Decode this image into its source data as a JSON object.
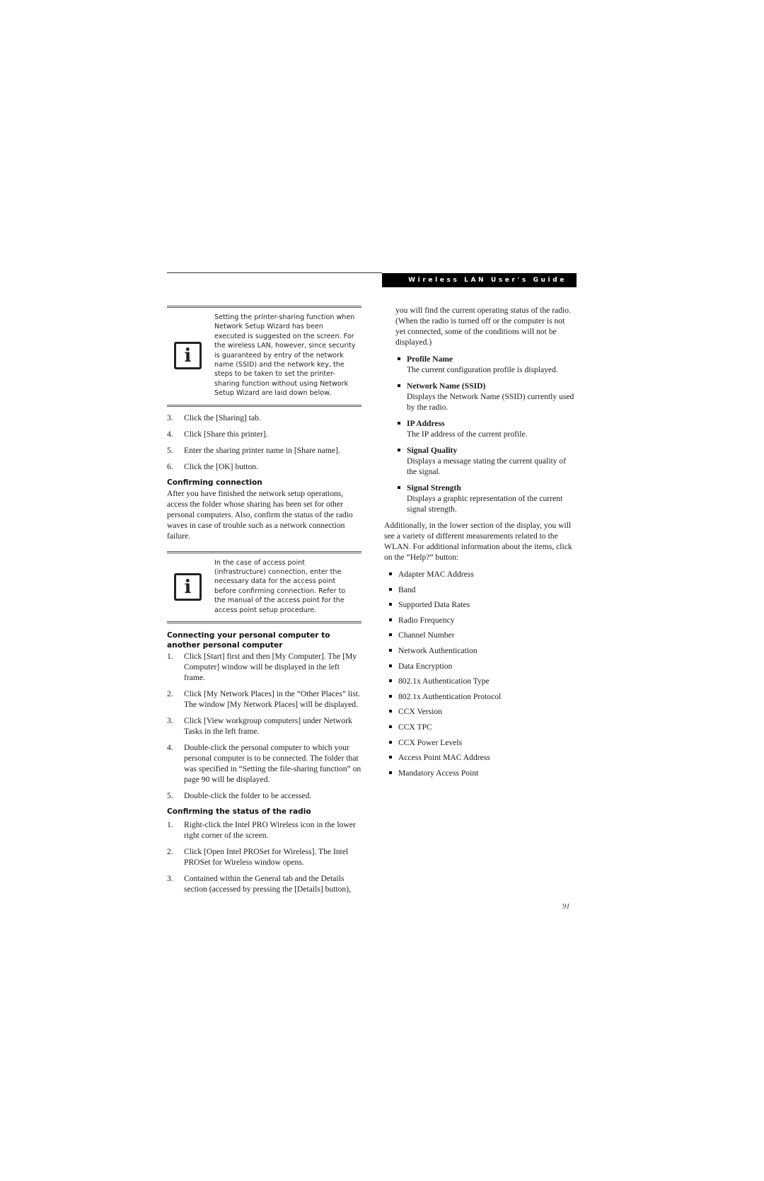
{
  "header": {
    "running_title": "Wireless LAN User's Guide"
  },
  "left_column": {
    "note_1": {
      "icon": "info-icon",
      "icon_glyph": "i",
      "text": "Setting the printer-sharing function when Network Setup Wizard has been executed is suggested on the screen. For the wireless LAN, however, since security is guaranteed by entry of the network name (SSID) and the network key, the steps to be taken to set the printer-sharing function without using Network Setup Wizard are laid down below."
    },
    "printer_steps": [
      {
        "num": "3.",
        "text": "Click the [Sharing] tab."
      },
      {
        "num": "4.",
        "text": "Click [Share this printer]."
      },
      {
        "num": "5.",
        "text": "Enter the sharing printer name in [Share name]."
      },
      {
        "num": "6.",
        "text": "Click the [OK] button."
      }
    ],
    "confirming_connection": {
      "heading": "Confirming connection",
      "body": "After you have finished the network setup operations, access the folder whose sharing has been set for other personal computers. Also, confirm the status of the radio waves in case of trouble such as a network connection failure."
    },
    "note_2": {
      "icon": "info-icon",
      "icon_glyph": "i",
      "text": "In the case of access point (infrastructure) connection, enter the necessary data for the access point before confirming connection. Refer to the manual of the access point for the access point setup procedure."
    },
    "connecting_pc": {
      "heading": "Connecting your personal computer to another personal computer",
      "steps": [
        {
          "num": "1.",
          "text": "Click [Start] first and then [My Computer]. The [My Computer] window will be displayed in the left frame."
        },
        {
          "num": "2.",
          "text": "Click [My Network Places] in the “Other Places” list. The window [My Network Places] will be displayed."
        },
        {
          "num": "3.",
          "text": "Click [View workgroup computers] under Network Tasks in the left frame."
        },
        {
          "num": "4.",
          "text": "Double-click the personal computer to which your personal computer is to be connected. The folder that was specified in “Setting the file-sharing function” on page 90 will be displayed."
        },
        {
          "num": "5.",
          "text": "Double-click the folder to be accessed."
        }
      ]
    },
    "radio_status": {
      "heading": "Confirming the status of the radio",
      "steps": [
        {
          "num": "1.",
          "text": "Right-click the Intel PRO Wireless icon in the lower right corner of the screen."
        },
        {
          "num": "2.",
          "text": "Click [Open Intel PROSet for Wireless]. The Intel PROSet for Wireless window opens."
        },
        {
          "num": "3.",
          "text": "Contained within the General tab and the Details section (accessed by pressing the [Details] button),"
        }
      ]
    }
  },
  "right_column": {
    "intro": "you will find the current operating status of the radio. (When the radio is turned off or the computer is not yet connected, some of the conditions will not be displayed.)",
    "status_items": [
      {
        "term": "Profile Name",
        "desc": "The current configuration profile is displayed."
      },
      {
        "term": "Network Name (SSID)",
        "desc": "Displays the Network Name (SSID) currently used by the radio."
      },
      {
        "term": "IP Address",
        "desc": "The IP address of the current profile."
      },
      {
        "term": "Signal Quality",
        "desc": "Displays a message stating the current quality of the signal."
      },
      {
        "term": "Signal Strength",
        "desc": "Displays a graphic representation of the current signal strength."
      }
    ],
    "additional": "Additionally, in the lower section of the display, you will see a variety of different measurements related to the WLAN. For additional information about the items, click on the “Help?” button:",
    "measurements": [
      "Adapter MAC Address",
      "Band",
      "Supported Data Rates",
      "Radio Frequency",
      "Channel Number",
      "Network Authentication",
      "Data Encryption",
      "802.1x Authentication Type",
      "802.1x Authentication Protocol",
      "CCX Version",
      "CCX TPC",
      "CCX Power Levels",
      "Access Point MAC Address",
      "Mandatory Access Point"
    ]
  },
  "footer": {
    "page_number": "91"
  }
}
